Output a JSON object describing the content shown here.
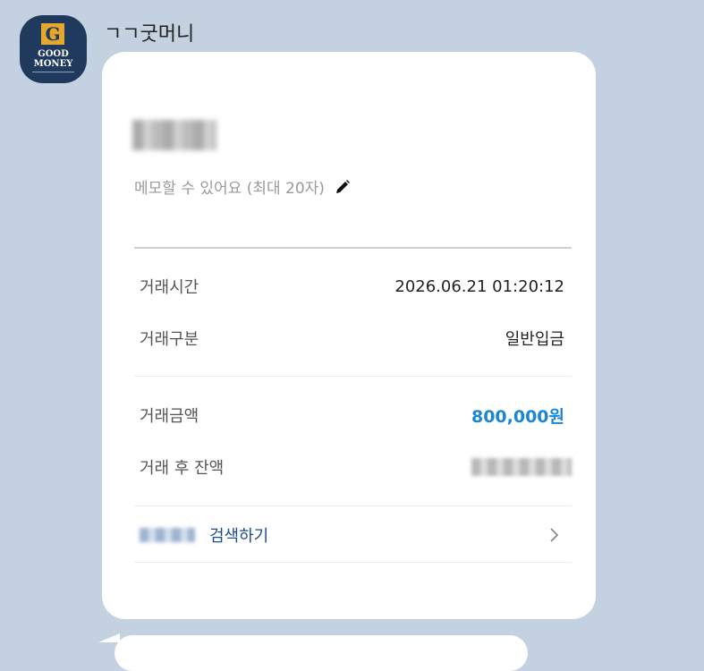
{
  "sender": {
    "name": "ㄱㄱ굿머니",
    "avatar_logo_line1": "GOOD",
    "avatar_logo_line2": "MONEY",
    "avatar_letter": "G"
  },
  "card": {
    "memo_placeholder": "메모할 수 있어요 (최대 20자)",
    "rows": [
      {
        "label": "거래시간",
        "value": "2026.06.21 01:20:12"
      },
      {
        "label": "거래구분",
        "value": "일반입금"
      },
      {
        "label": "거래금액",
        "value": "800,000원"
      },
      {
        "label": "거래 후 잔액",
        "value": ""
      }
    ],
    "search_label": "검색하기"
  },
  "icons": {
    "edit": "pencil-icon",
    "chevron": "chevron-right-icon"
  },
  "colors": {
    "background": "#c3d1e0",
    "card": "#ffffff",
    "amount": "#1b86d4",
    "link": "#1f4d8c",
    "avatar": "#1f3a5c",
    "avatar_accent": "#e3a82d"
  }
}
